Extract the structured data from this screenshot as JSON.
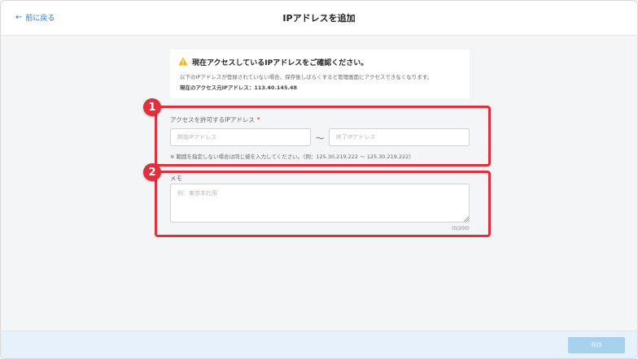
{
  "header": {
    "back_label": "前に戻る",
    "title": "IPアドレスを追加"
  },
  "notice": {
    "icon": "warning-triangle-icon",
    "title": "現在アクセスしているIPアドレスをご確認ください。",
    "text": "以下のIPアドレスが登録されていない場合、保存後しばらくすると管理画面にアクセスできなくなります。",
    "current_ip": "現在のアクセス元IPアドレス：113.40.145.48"
  },
  "badges": [
    "1",
    "2"
  ],
  "ip_range": {
    "label": "アクセスを許可するIPアドレス",
    "required_mark": "*",
    "start_placeholder": "開始IPアドレス",
    "start_value": "",
    "separator": "〜",
    "end_placeholder": "終了IPアドレス",
    "end_value": "",
    "hint": "※ 範囲を指定しない場合は同じ値を入力してください。（例：125.30.219.222 〜 125.30.219.222）"
  },
  "memo": {
    "label": "メモ",
    "placeholder": "例：東京本社用",
    "value": "",
    "counter": "(0/200)"
  },
  "footer": {
    "save_label": "保存",
    "save_enabled": false
  },
  "colors": {
    "accent": "#2a76c6",
    "highlight": "#e0303c",
    "warning": "#f2b705",
    "save_disabled": "#a6d2f0"
  }
}
